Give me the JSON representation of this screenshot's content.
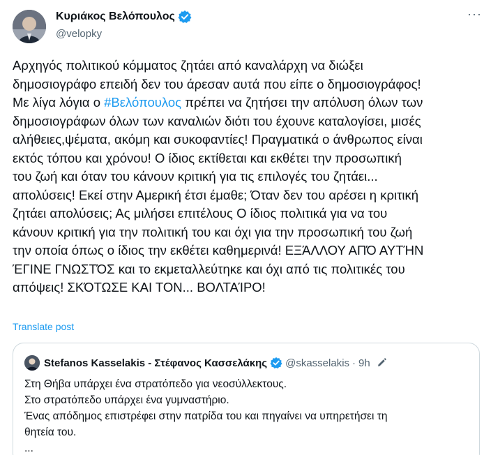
{
  "post": {
    "author_name": "Κυριάκος Βελόπουλος",
    "handle": "@velopky",
    "more_label": "···",
    "text_before_hashtag": "Αρχηγός πολιτικού κόμματος ζητάει από καναλάρχη να διώξει\nδημοσιογράφο επειδή δεν του άρεσαν αυτά που είπε ο δημοσιογράφος!\nΜε λίγα λόγια ο ",
    "hashtag": "#Βελόπουλος",
    "text_after_hashtag": " πρέπει να ζητήσει την απόλυση όλων των\nδημοσιογράφων όλων των καναλιών διότι του έχουνε καταλογίσει, μισές\nαλήθειες,ψέματα, ακόμη και συκοφαντίες! Πραγματικά ο άνθρωπος είναι\nεκτός τόπου και χρόνου! Ο ίδιος εκτίθεται και εκθέτει την προσωπική\nτου ζωή και όταν του κάνουν κριτική για τις επιλογές του ζητάει...\nαπολύσεις! Εκεί στην Αμερική έτσι έμαθε; Όταν δεν του αρέσει η κριτική\nζητάει απολύσεις; Ας μιλήσει επιτέλους Ο ίδιος πολιτικά για να του\nκάνουν κριτική για την πολιτική του και όχι για την προσωπική του ζωή\nτην οποία όπως ο ίδιος την εκθέτει καθημερινά! ΕΞΆΛΛΟΥ ΑΠΌ ΑΥΤΉΝ\nΈΓΙΝΕ ΓΝΩΣΤΌΣ και το εκμεταλλεύτηκε και όχι από τις πολιτικές του\nαπόψεις! ΣΚΌΤΩΣΕ ΚΑΙ ΤΟΝ... ΒΟΛΤΑΊΡΟ!",
    "translate_label": "Translate post"
  },
  "quote": {
    "author_name": "Stefanos Kasselakis - Στέφανος Κασσελάκης",
    "handle": "@skasselakis",
    "separator": "·",
    "time": "9h",
    "lines": [
      "Στη Θήβα υπάρχει ένα στρατόπεδο για νεοσύλλεκτους.",
      "Στο στρατόπεδο υπάρχει ένα γυμναστήριο.",
      "Ένας απόδημος επιστρέφει στην πατρίδα του και πηγαίνει να υπηρετήσει τη",
      "θητεία του.",
      "..."
    ]
  },
  "colors": {
    "accent": "#1d9bf0",
    "text": "#0f1419",
    "muted": "#536471",
    "border": "#cfd9de"
  },
  "icons": [
    "verified-badge-icon",
    "more-icon",
    "edit-icon"
  ]
}
